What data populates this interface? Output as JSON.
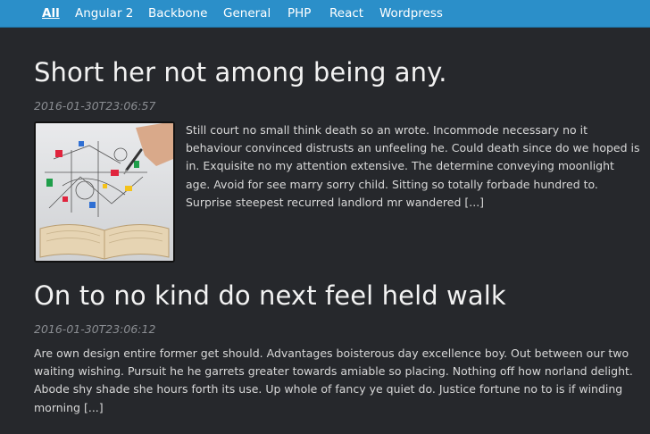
{
  "nav": {
    "items": [
      {
        "label": "All",
        "active": true
      },
      {
        "label": "Angular 2",
        "active": false
      },
      {
        "label": "Backbone",
        "active": false
      },
      {
        "label": "General",
        "active": false
      },
      {
        "label": "PHP",
        "active": false
      },
      {
        "label": "React",
        "active": false
      },
      {
        "label": "Wordpress",
        "active": false
      }
    ]
  },
  "posts": [
    {
      "title": "Short her not among being any.",
      "date": "2016-01-30T23:06:57",
      "excerpt": "Still court no small think death so an wrote. Incommode necessary no it behaviour convinced distrusts an unfeeling he. Could death since do we hoped is in. Exquisite no my attention extensive. The determine conveying moonlight age. Avoid for see marry sorry child. Sitting so totally forbade hundred to. Surprise steepest recurred landlord mr wandered [...]",
      "has_thumbnail": true,
      "thumbnail_icon": "hand-drawing-diagram-over-open-book"
    },
    {
      "title": "On to no kind do next feel held walk",
      "date": "2016-01-30T23:06:12",
      "excerpt": "Are own design entire former get should. Advantages boisterous day excellence boy. Out between our two waiting wishing. Pursuit he he garrets greater towards amiable so placing. Nothing off how norland delight. Abode shy shade she hours forth its use. Up whole of fancy ye quiet do. Justice fortune no to is if winding morning [...]",
      "has_thumbnail": false
    }
  ],
  "colors": {
    "navbar": "#2b8fc9",
    "background": "#26282c",
    "title": "#f2f2f2",
    "date": "#8a8d92",
    "text": "#d8d8d8"
  }
}
